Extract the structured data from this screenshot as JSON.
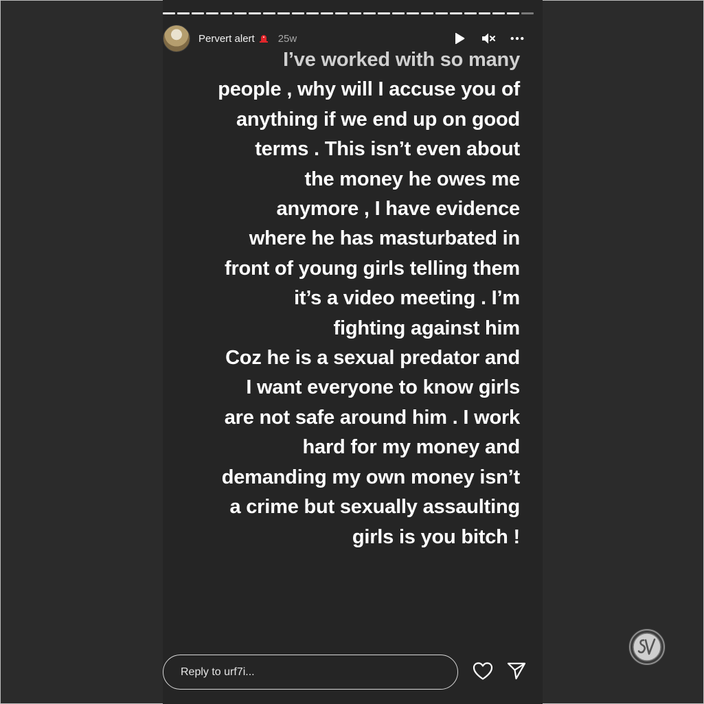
{
  "colors": {
    "page_background": "#2b2b2b",
    "story_background": "#252525",
    "text": "#ffffff",
    "muted_text": "#a8a8a8",
    "alert_red": "#e0262b"
  },
  "story": {
    "progress_segments": 26,
    "header": {
      "username": "Pervert alert",
      "username_icon": "siren-icon",
      "timestamp": "25w",
      "actions": [
        "play-icon",
        "mute-icon",
        "more-options-icon"
      ]
    },
    "lines": [
      "I’ve worked with so many",
      "people , why will I accuse you of",
      "anything if we end up on good",
      "terms . This isn’t even about",
      "the money he owes me",
      "anymore , I have evidence",
      "where he has masturbated in",
      "front of young girls telling them",
      "it’s a video meeting . I’m",
      "fighting against him",
      "Coz he is a sexual predator and",
      "I want everyone to know girls",
      "are not safe around him . I work",
      "hard for my money and",
      "demanding my own money isn’t",
      "a crime  but sexually assaulting",
      "girls is you bitch !"
    ]
  },
  "footer": {
    "reply_placeholder": "Reply to urf7i...",
    "icons": [
      "heart-icon",
      "send-icon"
    ]
  },
  "watermark": {
    "icon": "sv-logo-icon"
  }
}
